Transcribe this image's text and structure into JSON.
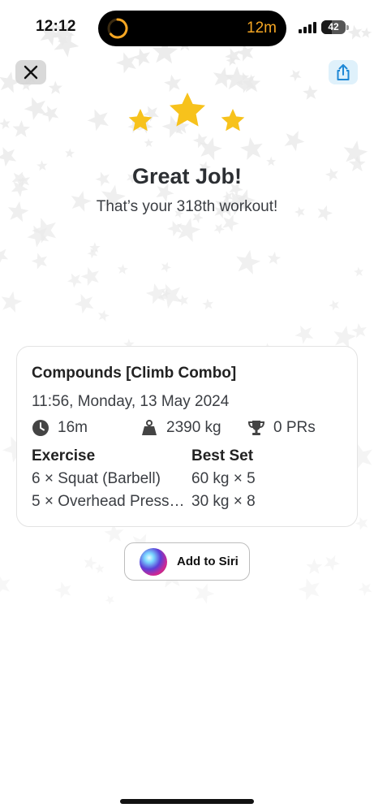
{
  "status_bar": {
    "time": "12:12",
    "live_activity_timer": "12m",
    "battery_level": "42",
    "accent_color": "#f5a623"
  },
  "header": {
    "close_icon": "close-icon",
    "share_icon": "share-icon"
  },
  "celebration": {
    "stars": 3,
    "star_color": "#f7c21c",
    "headline": "Great Job!",
    "subline": "That’s your 318th workout!"
  },
  "workout_card": {
    "title": "Compounds [Climb Combo]",
    "date": "11:56, Monday, 13 May 2024",
    "stats": {
      "duration": "16m",
      "volume": "2390 kg",
      "prs": "0 PRs"
    },
    "columns": {
      "exercise": "Exercise",
      "best_set": "Best Set"
    },
    "rows": [
      {
        "exercise": "6 × Squat (Barbell)",
        "best_set": "60 kg × 5"
      },
      {
        "exercise": "5 × Overhead Press…",
        "best_set": "30 kg × 8"
      }
    ]
  },
  "siri": {
    "label": "Add to Siri"
  }
}
